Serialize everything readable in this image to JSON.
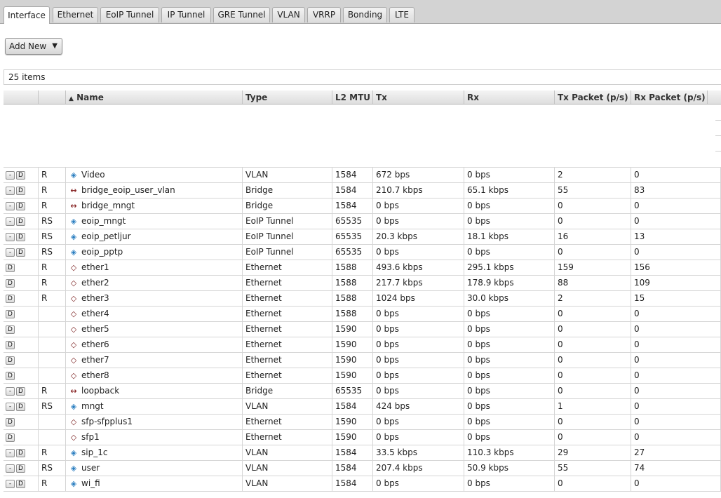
{
  "tabs": [
    {
      "label": "Interface",
      "active": true
    },
    {
      "label": "Ethernet"
    },
    {
      "label": "EoIP Tunnel"
    },
    {
      "label": "IP Tunnel"
    },
    {
      "label": "GRE Tunnel"
    },
    {
      "label": "VLAN"
    },
    {
      "label": "VRRP"
    },
    {
      "label": "Bonding"
    },
    {
      "label": "LTE"
    }
  ],
  "toolbar": {
    "add_new_label": "Add New",
    "add_new_arrow": "▼"
  },
  "item_count": "25 items",
  "columns": [
    {
      "key": "sort",
      "label": ""
    },
    {
      "key": "flags",
      "label": ""
    },
    {
      "key": "name",
      "label": "Name",
      "sort_indicator": "▲"
    },
    {
      "key": "type",
      "label": "Type"
    },
    {
      "key": "mtu",
      "label": "L2 MTU"
    },
    {
      "key": "tx",
      "label": "Tx"
    },
    {
      "key": "rx",
      "label": "Rx"
    },
    {
      "key": "txp",
      "label": "Tx Packet (p/s)"
    },
    {
      "key": "rxp",
      "label": "Rx Packet (p/s)"
    }
  ],
  "row_buttons": {
    "remove": "-",
    "disable": "D"
  },
  "rows": [
    {
      "removable": true,
      "flags": "R",
      "icon": "vlan-icon",
      "name": "Video",
      "type": "VLAN",
      "mtu": "1584",
      "tx": "672 bps",
      "rx": "0 bps",
      "txp": "2",
      "rxp": "0"
    },
    {
      "removable": true,
      "flags": "R",
      "icon": "bridge-icon",
      "name": "bridge_eoip_user_vlan",
      "type": "Bridge",
      "mtu": "1584",
      "tx": "210.7 kbps",
      "rx": "65.1 kbps",
      "txp": "55",
      "rxp": "83"
    },
    {
      "removable": true,
      "flags": "R",
      "icon": "bridge-icon",
      "name": "bridge_mngt",
      "type": "Bridge",
      "mtu": "1584",
      "tx": "0 bps",
      "rx": "0 bps",
      "txp": "0",
      "rxp": "0"
    },
    {
      "removable": true,
      "flags": "RS",
      "icon": "eoip-icon",
      "name": "eoip_mngt",
      "type": "EoIP Tunnel",
      "mtu": "65535",
      "tx": "0 bps",
      "rx": "0 bps",
      "txp": "0",
      "rxp": "0"
    },
    {
      "removable": true,
      "flags": "RS",
      "icon": "eoip-icon",
      "name": "eoip_petljur",
      "type": "EoIP Tunnel",
      "mtu": "65535",
      "tx": "20.3 kbps",
      "rx": "18.1 kbps",
      "txp": "16",
      "rxp": "13"
    },
    {
      "removable": true,
      "flags": "RS",
      "icon": "eoip-icon",
      "name": "eoip_pptp",
      "type": "EoIP Tunnel",
      "mtu": "65535",
      "tx": "0 bps",
      "rx": "0 bps",
      "txp": "0",
      "rxp": "0"
    },
    {
      "removable": false,
      "flags": "R",
      "icon": "ethernet-icon",
      "name": "ether1",
      "type": "Ethernet",
      "mtu": "1588",
      "tx": "493.6 kbps",
      "rx": "295.1 kbps",
      "txp": "159",
      "rxp": "156"
    },
    {
      "removable": false,
      "flags": "R",
      "icon": "ethernet-icon",
      "name": "ether2",
      "type": "Ethernet",
      "mtu": "1588",
      "tx": "217.7 kbps",
      "rx": "178.9 kbps",
      "txp": "88",
      "rxp": "109"
    },
    {
      "removable": false,
      "flags": "R",
      "icon": "ethernet-icon",
      "name": "ether3",
      "type": "Ethernet",
      "mtu": "1588",
      "tx": "1024 bps",
      "rx": "30.0 kbps",
      "txp": "2",
      "rxp": "15"
    },
    {
      "removable": false,
      "flags": "",
      "icon": "ethernet-icon",
      "name": "ether4",
      "type": "Ethernet",
      "mtu": "1588",
      "tx": "0 bps",
      "rx": "0 bps",
      "txp": "0",
      "rxp": "0"
    },
    {
      "removable": false,
      "flags": "",
      "icon": "ethernet-icon",
      "name": "ether5",
      "type": "Ethernet",
      "mtu": "1590",
      "tx": "0 bps",
      "rx": "0 bps",
      "txp": "0",
      "rxp": "0"
    },
    {
      "removable": false,
      "flags": "",
      "icon": "ethernet-icon",
      "name": "ether6",
      "type": "Ethernet",
      "mtu": "1590",
      "tx": "0 bps",
      "rx": "0 bps",
      "txp": "0",
      "rxp": "0"
    },
    {
      "removable": false,
      "flags": "",
      "icon": "ethernet-icon",
      "name": "ether7",
      "type": "Ethernet",
      "mtu": "1590",
      "tx": "0 bps",
      "rx": "0 bps",
      "txp": "0",
      "rxp": "0"
    },
    {
      "removable": false,
      "flags": "",
      "icon": "ethernet-icon",
      "name": "ether8",
      "type": "Ethernet",
      "mtu": "1590",
      "tx": "0 bps",
      "rx": "0 bps",
      "txp": "0",
      "rxp": "0"
    },
    {
      "removable": true,
      "flags": "R",
      "icon": "bridge-icon",
      "name": "loopback",
      "type": "Bridge",
      "mtu": "65535",
      "tx": "0 bps",
      "rx": "0 bps",
      "txp": "0",
      "rxp": "0"
    },
    {
      "removable": true,
      "flags": "RS",
      "icon": "vlan-icon",
      "name": "mngt",
      "type": "VLAN",
      "mtu": "1584",
      "tx": "424 bps",
      "rx": "0 bps",
      "txp": "1",
      "rxp": "0"
    },
    {
      "removable": false,
      "flags": "",
      "icon": "ethernet-icon",
      "name": "sfp-sfpplus1",
      "type": "Ethernet",
      "mtu": "1590",
      "tx": "0 bps",
      "rx": "0 bps",
      "txp": "0",
      "rxp": "0"
    },
    {
      "removable": false,
      "flags": "",
      "icon": "ethernet-icon",
      "name": "sfp1",
      "type": "Ethernet",
      "mtu": "1590",
      "tx": "0 bps",
      "rx": "0 bps",
      "txp": "0",
      "rxp": "0"
    },
    {
      "removable": true,
      "flags": "R",
      "icon": "vlan-icon",
      "name": "sip_1c",
      "type": "VLAN",
      "mtu": "1584",
      "tx": "33.5 kbps",
      "rx": "110.3 kbps",
      "txp": "29",
      "rxp": "27"
    },
    {
      "removable": true,
      "flags": "RS",
      "icon": "vlan-icon",
      "name": "user",
      "type": "VLAN",
      "mtu": "1584",
      "tx": "207.4 kbps",
      "rx": "50.9 kbps",
      "txp": "55",
      "rxp": "74"
    },
    {
      "removable": true,
      "flags": "R",
      "icon": "vlan-icon",
      "name": "wi_fi",
      "type": "VLAN",
      "mtu": "1584",
      "tx": "0 bps",
      "rx": "0 bps",
      "txp": "0",
      "rxp": "0"
    }
  ]
}
